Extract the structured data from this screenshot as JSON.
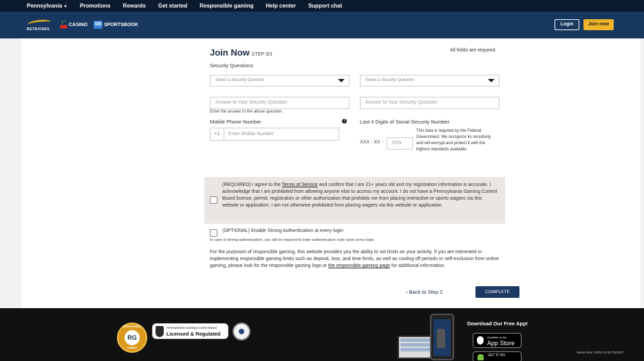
{
  "topnav": {
    "items": [
      "Pennsylvania",
      "Promotions",
      "Rewards",
      "Get started",
      "Responsible gaming",
      "Help center",
      "Support chat"
    ]
  },
  "brand": {
    "logo": "BETRIVERS",
    "casino": "CASINO",
    "sportsbook": "SPORTSBOOK",
    "sb_mark": "SB",
    "login": "Login",
    "join": "Join now"
  },
  "form": {
    "title": "Join Now",
    "step": "STEP 3/3",
    "required_note": "All fields are required",
    "security_label": "Security Questions",
    "select1_placeholder": "Select a Security Question",
    "select2_placeholder": "Select a Security Question",
    "answer1_placeholder": "Answer to Your Security Question",
    "answer2_placeholder": "Answer to Your Security Question",
    "answer_hint": "Enter the answer to the above question.",
    "mobile_label": "Mobile Phone Number",
    "country_code": "+1",
    "mobile_placeholder": "Enter Mobile Number",
    "ssn_label": "Last 4 Digits of Social Security Number.",
    "ssn_prefix": "XXX - XX -",
    "ssn_placeholder": "SSN",
    "ssn_note": "This data is required by the Federal Government. We recognize its sensitivity and will encrypt and protect it with the highest standards available.",
    "agree_pre": "(REQUIRED) I agree to the ",
    "agree_link": "Terms of Service",
    "agree_post": " and confirm that I am 21+ years old and my registration information is accurate. I acknowledge that I am prohibited from allowing anyone else to access my account. I do not have a Pennsylvania Gaming Control Board license, permit, registration or other authorization that prohibits me from placing interactive or sports wagers via this website or application. I am not otherwise prohibited from placing wagers via this website or application.",
    "optional_label": "(OPTIONAL) Enable Strong Authentication at every login",
    "optional_hint": "In case of strong authentication, you will be required to enter authentication code upon every login.",
    "resp_pre": "For the purposes of responsible gaming, this website provides you the ability to set limits on your activity. If you are interested in implementing responsible gaming limits such as deposit, loss, and time limits, as well as cooling off periods or self-exclusion from online gaming, please look for the responsible gaming logo or ",
    "resp_link": "the responsible gaming page",
    "resp_post": " for additional information.",
    "back": "Back to Step 2",
    "complete": "COMPLETE"
  },
  "footer": {
    "rg_top": "RESPONSIBLE",
    "rg_mark": "RG",
    "rg_bottom": "GAMING",
    "pgcb_line1": "Pennsylvania Gaming Control Board",
    "pgcb_line2": "Licensed & Regulated",
    "download_title": "Download Our Free App!",
    "appstore_small": "Available on the",
    "appstore_big": "App Store",
    "gplay_small": "GET IT ON",
    "server_time": "Server time: 3/2/23 12:51 PM EST"
  }
}
